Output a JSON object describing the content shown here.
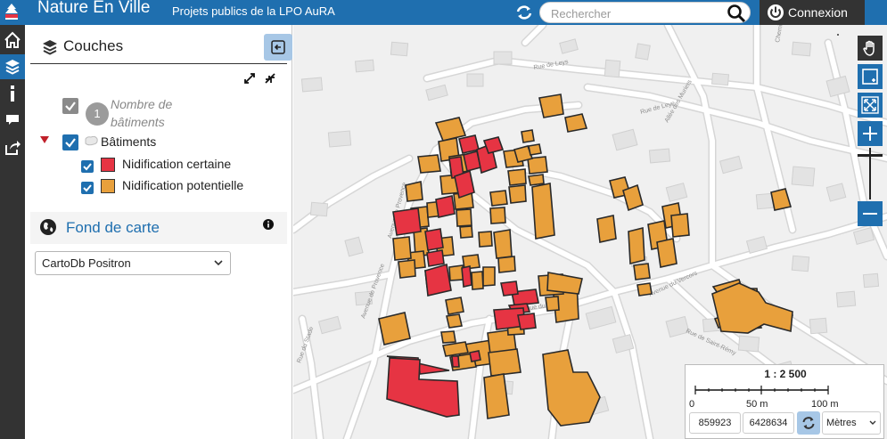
{
  "header": {
    "title": "Nature En Ville",
    "subtitle": "Projets publics de la LPO AuRA",
    "search_placeholder": "Rechercher",
    "login_label": "Connexion",
    "color": "#1f6faf"
  },
  "sidebar_icons": [
    "home-icon",
    "layers-icon",
    "info-icon",
    "comment-icon",
    "share-icon"
  ],
  "panel": {
    "title": "Couches",
    "layers": [
      {
        "label": "Nombre de bâtiments",
        "badge": "1",
        "checked": true,
        "style": "italic-gray"
      },
      {
        "label": "Bâtiments",
        "checked": true,
        "expanded": true,
        "children": [
          {
            "label": "Nidification certaine",
            "checked": true,
            "color": "#e63443"
          },
          {
            "label": "Nidification potentielle",
            "checked": true,
            "color": "#e8a03c"
          }
        ]
      }
    ],
    "basemap_title": "Fond de carte",
    "basemap_value": "CartoDb Positron"
  },
  "map": {
    "street_labels": [
      "Rue de Leys",
      "Rue de Leye",
      "Allée des Muriers",
      "Avenue de Provence",
      "Avenue de Provence",
      "Avenue du Vercors",
      "Avenue du Vercors",
      "Rue du Stade",
      "Rue de Saint-Rémy",
      "Chemin de la Rousset"
    ],
    "scale": {
      "ratio": "1 : 2 500",
      "ticks": [
        "0",
        "50 m",
        "100 m"
      ]
    },
    "coords": {
      "x": "859923",
      "y": "6428634",
      "units": "Mètres"
    },
    "buildings": {
      "certaine_color": "#e63443",
      "potentielle_color": "#e8a03c"
    }
  }
}
